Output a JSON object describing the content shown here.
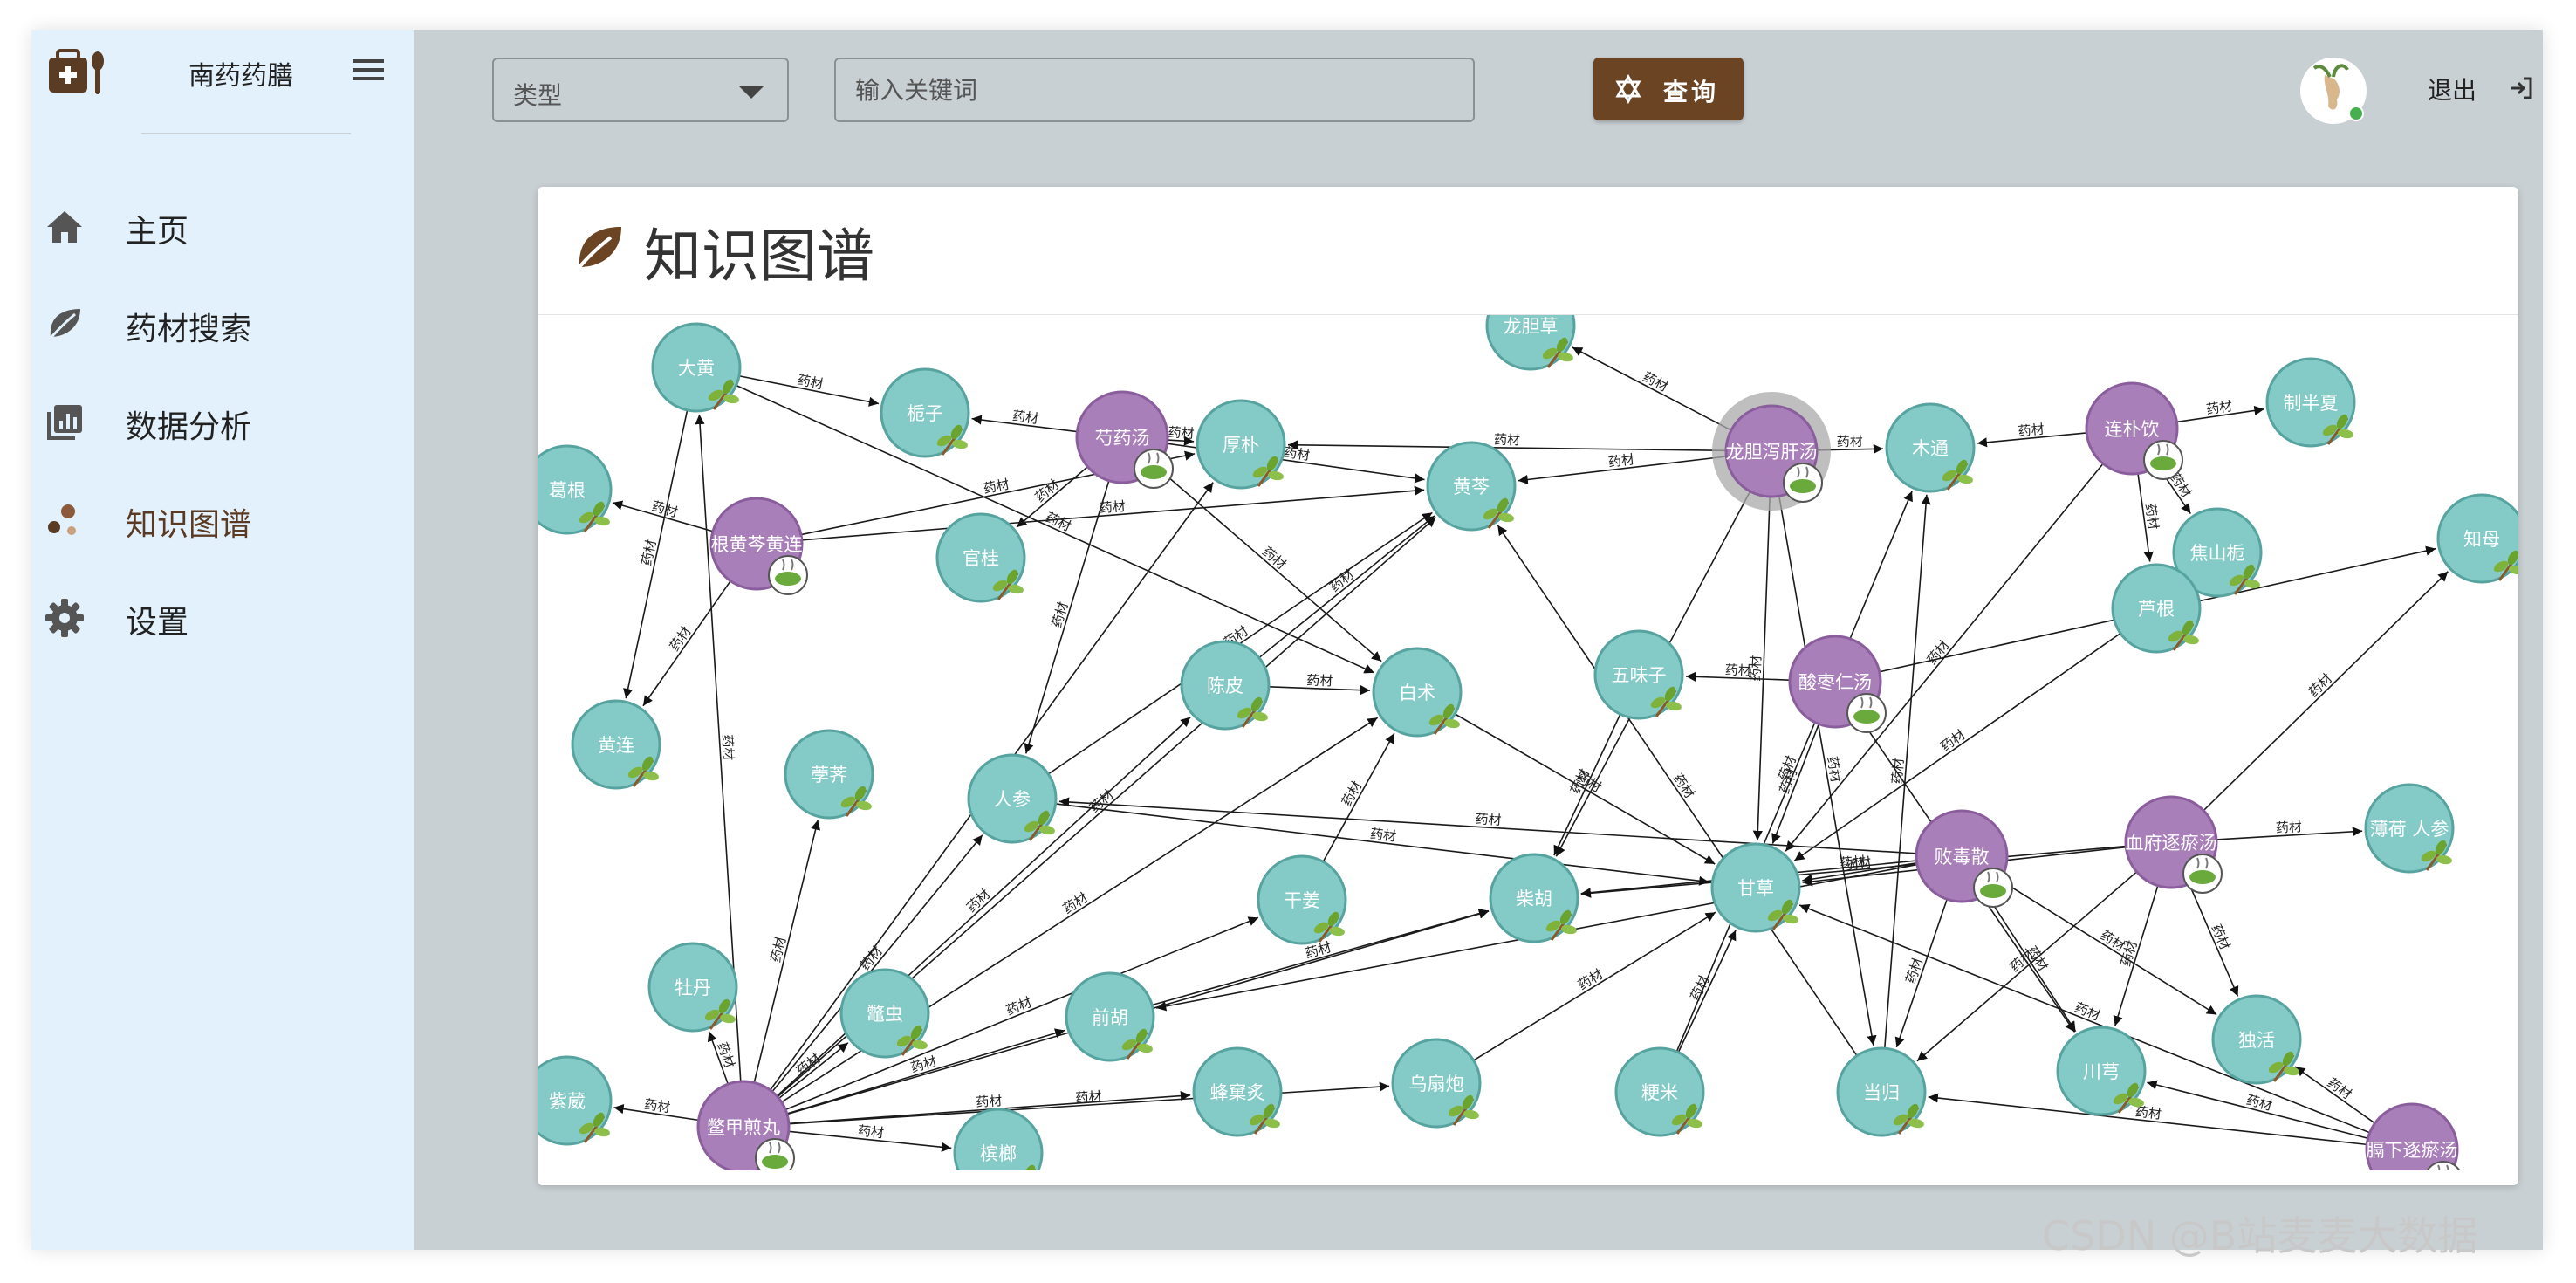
{
  "sidebar": {
    "brand": "南药药膳",
    "items": [
      {
        "label": "主页",
        "icon": "home-icon"
      },
      {
        "label": "药材搜索",
        "icon": "leaf-icon"
      },
      {
        "label": "数据分析",
        "icon": "chart-icon"
      },
      {
        "label": "知识图谱",
        "icon": "graph-icon"
      },
      {
        "label": "设置",
        "icon": "gear-icon"
      }
    ],
    "active_index": 3
  },
  "toolbar": {
    "type_select": "类型",
    "keyword_placeholder": "输入关键词",
    "query_label": "查询",
    "logout_label": "退出"
  },
  "card": {
    "title": "知识图谱"
  },
  "graph": {
    "edge_label": "药材",
    "nodes": [
      {
        "id": "大黄",
        "type": "herb"
      },
      {
        "id": "栀子",
        "type": "herb"
      },
      {
        "id": "芍药汤",
        "type": "formula"
      },
      {
        "id": "厚朴",
        "type": "herb"
      },
      {
        "id": "龙胆草",
        "type": "herb"
      },
      {
        "id": "黄芩",
        "type": "herb"
      },
      {
        "id": "龙胆泻肝汤",
        "type": "formula"
      },
      {
        "id": "木通",
        "type": "herb"
      },
      {
        "id": "连朴饮",
        "type": "formula"
      },
      {
        "id": "制半夏",
        "type": "herb"
      },
      {
        "id": "葛根",
        "type": "herb"
      },
      {
        "id": "根黄芩黄连",
        "type": "formula"
      },
      {
        "id": "官桂",
        "type": "herb"
      },
      {
        "id": "焦山栀",
        "type": "herb"
      },
      {
        "id": "知母",
        "type": "herb"
      },
      {
        "id": "芦根",
        "type": "herb"
      },
      {
        "id": "酸枣仁汤",
        "type": "formula"
      },
      {
        "id": "五味子",
        "type": "herb"
      },
      {
        "id": "陈皮",
        "type": "herb"
      },
      {
        "id": "白术",
        "type": "herb"
      },
      {
        "id": "黄连",
        "type": "herb"
      },
      {
        "id": "荸荠",
        "type": "herb"
      },
      {
        "id": "人参",
        "type": "herb"
      },
      {
        "id": "薄荷 人参",
        "type": "herb"
      },
      {
        "id": "血府逐瘀汤",
        "type": "formula"
      },
      {
        "id": "败毒散",
        "type": "formula"
      },
      {
        "id": "甘草",
        "type": "herb"
      },
      {
        "id": "柴胡",
        "type": "herb"
      },
      {
        "id": "干姜",
        "type": "herb"
      },
      {
        "id": "牡丹",
        "type": "herb"
      },
      {
        "id": "鼈虫",
        "type": "herb"
      },
      {
        "id": "前胡",
        "type": "herb"
      },
      {
        "id": "独活",
        "type": "herb"
      },
      {
        "id": "川芎",
        "type": "herb"
      },
      {
        "id": "当归",
        "type": "herb"
      },
      {
        "id": "粳米",
        "type": "herb"
      },
      {
        "id": "乌扇炮",
        "type": "herb"
      },
      {
        "id": "蜂窠炙",
        "type": "herb"
      },
      {
        "id": "紫葳",
        "type": "herb"
      },
      {
        "id": "鳖甲煎丸",
        "type": "formula"
      },
      {
        "id": "槟榔",
        "type": "herb"
      },
      {
        "id": "膈下逐瘀汤",
        "type": "formula"
      }
    ],
    "links": [
      [
        "芍药汤",
        "厚朴"
      ],
      [
        "芍药汤",
        "黄芩"
      ],
      [
        "芍药汤",
        "白术"
      ],
      [
        "芍药汤",
        "官桂"
      ],
      [
        "芍药汤",
        "人参"
      ],
      [
        "芍药汤",
        "栀子"
      ],
      [
        "龙胆泻肝汤",
        "黄芩"
      ],
      [
        "龙胆泻肝汤",
        "木通"
      ],
      [
        "龙胆泻肝汤",
        "龙胆草"
      ],
      [
        "龙胆泻肝汤",
        "甘草"
      ],
      [
        "龙胆泻肝汤",
        "柴胡"
      ],
      [
        "龙胆泻肝汤",
        "当归"
      ],
      [
        "龙胆泻肝汤",
        "厚朴"
      ],
      [
        "连朴饮",
        "木通"
      ],
      [
        "连朴饮",
        "制半夏"
      ],
      [
        "连朴饮",
        "芦根"
      ],
      [
        "连朴饮",
        "焦山栀"
      ],
      [
        "连朴饮",
        "甘草"
      ],
      [
        "根黄芩黄连",
        "葛根"
      ],
      [
        "根黄芩黄连",
        "黄芩"
      ],
      [
        "根黄芩黄连",
        "黄连"
      ],
      [
        "根黄芩黄连",
        "厚朴"
      ],
      [
        "酸枣仁汤",
        "甘草"
      ],
      [
        "酸枣仁汤",
        "知母"
      ],
      [
        "酸枣仁汤",
        "五味子"
      ],
      [
        "酸枣仁汤",
        "川芎"
      ],
      [
        "血府逐瘀汤",
        "甘草"
      ],
      [
        "血府逐瘀汤",
        "柴胡"
      ],
      [
        "血府逐瘀汤",
        "川芎"
      ],
      [
        "血府逐瘀汤",
        "当归"
      ],
      [
        "血府逐瘀汤",
        "薄荷 人参"
      ],
      [
        "血府逐瘀汤",
        "独活"
      ],
      [
        "血府逐瘀汤",
        "知母"
      ],
      [
        "败毒散",
        "甘草"
      ],
      [
        "败毒散",
        "人参"
      ],
      [
        "败毒散",
        "柴胡"
      ],
      [
        "败毒散",
        "川芎"
      ],
      [
        "败毒散",
        "独活"
      ],
      [
        "败毒散",
        "前胡"
      ],
      [
        "败毒散",
        "当归"
      ],
      [
        "鳖甲煎丸",
        "人参"
      ],
      [
        "鳖甲煎丸",
        "黄芩"
      ],
      [
        "鳖甲煎丸",
        "柴胡"
      ],
      [
        "鳖甲煎丸",
        "干姜"
      ],
      [
        "鳖甲煎丸",
        "鼈虫"
      ],
      [
        "鳖甲煎丸",
        "牡丹"
      ],
      [
        "鳖甲煎丸",
        "紫葳"
      ],
      [
        "鳖甲煎丸",
        "蜂窠炙"
      ],
      [
        "鳖甲煎丸",
        "乌扇炮"
      ],
      [
        "鳖甲煎丸",
        "大黄"
      ],
      [
        "鳖甲煎丸",
        "厚朴"
      ],
      [
        "鳖甲煎丸",
        "前胡"
      ],
      [
        "鳖甲煎丸",
        "槟榔"
      ],
      [
        "鳖甲煎丸",
        "陈皮"
      ],
      [
        "鳖甲煎丸",
        "白术"
      ],
      [
        "鳖甲煎丸",
        "荸荠"
      ],
      [
        "膈下逐瘀汤",
        "甘草"
      ],
      [
        "膈下逐瘀汤",
        "川芎"
      ],
      [
        "膈下逐瘀汤",
        "当归"
      ],
      [
        "膈下逐瘀汤",
        "独活"
      ],
      [
        "大黄",
        "栀子"
      ],
      [
        "大黄",
        "白术"
      ],
      [
        "大黄",
        "黄连"
      ],
      [
        "陈皮",
        "白术"
      ],
      [
        "陈皮",
        "黄芩"
      ],
      [
        "白术",
        "甘草"
      ],
      [
        "人参",
        "甘草"
      ],
      [
        "人参",
        "黄芩"
      ],
      [
        "前胡",
        "柴胡"
      ],
      [
        "干姜",
        "白术"
      ],
      [
        "粳米",
        "甘草"
      ],
      [
        "粳米",
        "木通"
      ],
      [
        "乌扇炮",
        "甘草"
      ],
      [
        "当归",
        "木通"
      ],
      [
        "当归",
        "黄芩"
      ],
      [
        "芦根",
        "甘草"
      ],
      [
        "五味子",
        "柴胡"
      ]
    ]
  }
}
